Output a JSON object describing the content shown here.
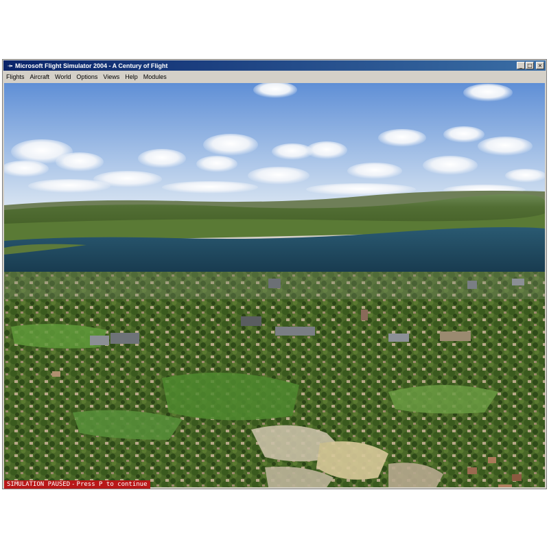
{
  "window": {
    "title": "Microsoft Flight Simulator 2004 - A Century of Flight",
    "icon": "plane-icon",
    "controls": {
      "minimize": "_",
      "maximize": "□",
      "close": "×"
    }
  },
  "menu": {
    "items": [
      "Flights",
      "Aircraft",
      "World",
      "Options",
      "Views",
      "Help",
      "Modules"
    ]
  },
  "status": {
    "paused": "SIMULATION PAUSED",
    "separator": "-",
    "hint": "Press P to continue"
  },
  "colors": {
    "titlebar_start": "#0a246a",
    "titlebar_end": "#3a6ea5",
    "status_bg": "#b81818",
    "sky_top": "#5f8fd6",
    "sky_horizon": "#dbe6f2",
    "water": "#1f4b62",
    "land": "#4c6a2c"
  }
}
